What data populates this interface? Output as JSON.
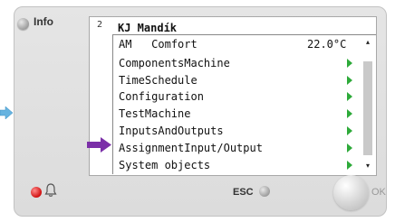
{
  "device": {
    "info_label": "Info",
    "esc_label": "ESC",
    "ok_label": "OK"
  },
  "screen": {
    "page_number": "2",
    "title": "KJ Mandík",
    "mode_row": {
      "prefix": "AM",
      "mode": "Comfort",
      "temperature": "22.0°C"
    },
    "menu_items": [
      {
        "label": "ComponentsMachine",
        "has_submenu": true
      },
      {
        "label": "TimeSchedule",
        "has_submenu": true
      },
      {
        "label": "Configuration",
        "has_submenu": true
      },
      {
        "label": "TestMachine",
        "has_submenu": true
      },
      {
        "label": "InputsAndOutputs",
        "has_submenu": true
      },
      {
        "label": "AssignmentInput/Output",
        "has_submenu": true
      },
      {
        "label": "System objects",
        "has_submenu": true
      }
    ],
    "highlighted_item": "AssignmentInput/Output"
  },
  "colors": {
    "submenu_arrow": "#2eaa3a",
    "pointer_arrow": "#7b2fa8",
    "side_arrow": "#66b3e0",
    "alarm_led": "#d01010"
  },
  "icons": {
    "submenu": "triangle-right-icon",
    "pointer": "arrow-right-icon",
    "alarm": "bell-icon"
  }
}
